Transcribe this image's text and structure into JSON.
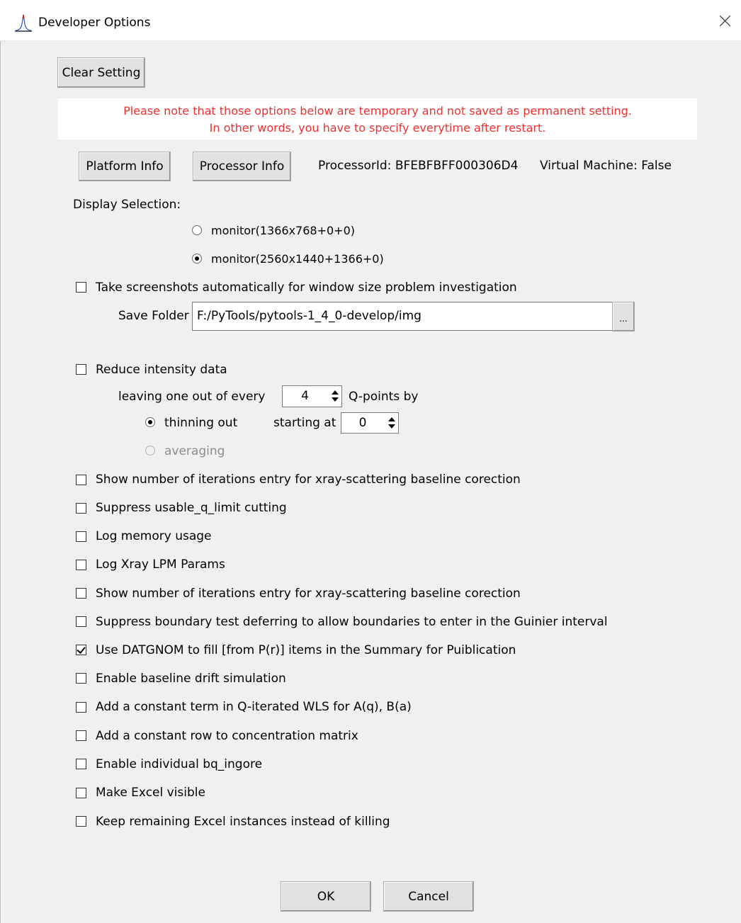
{
  "window": {
    "title": "Developer Options",
    "close_icon": "close-icon",
    "app_icon": "peak-icon"
  },
  "buttons": {
    "clear_setting": "Clear Setting",
    "platform_info": "Platform Info",
    "processor_info": "Processor Info",
    "ok": "OK",
    "cancel": "Cancel",
    "browse": "..."
  },
  "note": {
    "line1": "Please note that those options below are temporary and not saved as permanent setting.",
    "line2": "In other words, you have to specify everytime after restart.",
    "color": "#ee3030"
  },
  "info": {
    "processor_id": "ProcessorId: BFEBFBFF000306D4",
    "virtual_machine": "Virtual Machine: False"
  },
  "display": {
    "label": "Display Selection:",
    "options": [
      {
        "label": "monitor(1366x768+0+0)",
        "selected": false
      },
      {
        "label": "monitor(2560x1440+1366+0)",
        "selected": true
      }
    ]
  },
  "screenshots": {
    "label": "Take screenshots automatically for window size problem investigation",
    "checked": false,
    "save_folder_label": "Save Folder",
    "save_folder_value": "F:/PyTools/pytools-1_4_0-develop/img"
  },
  "reduce": {
    "label": "Reduce intensity data",
    "checked": false,
    "leaving_label": "leaving one out of every",
    "every_value": "4",
    "qpoints_label": "Q-points by",
    "thinning_label": "thinning out",
    "thinning_selected": true,
    "starting_label": "starting at",
    "starting_value": "0",
    "averaging_label": "averaging",
    "averaging_enabled": false
  },
  "options": [
    {
      "label": "Show number of iterations entry for xray-scattering baseline corection",
      "checked": false
    },
    {
      "label": "Suppress usable_q_limit cutting",
      "checked": false
    },
    {
      "label": "Log memory usage",
      "checked": false
    },
    {
      "label": "Log Xray LPM Params",
      "checked": false
    },
    {
      "label": "Show number of iterations entry for xray-scattering baseline corection",
      "checked": false
    },
    {
      "label": "Suppress boundary test deferring to allow boundaries to enter in the Guinier interval",
      "checked": false
    },
    {
      "label": "Use DATGNOM to fill [from P(r)] items in the Summary for Puiblication",
      "checked": true
    },
    {
      "label": "Enable baseline drift simulation",
      "checked": false
    },
    {
      "label": "Add a constant term in Q-iterated WLS for A(q), B(a)",
      "checked": false
    },
    {
      "label": "Add a constant row to concentration matrix",
      "checked": false
    },
    {
      "label": "Enable individual bq_ingore",
      "checked": false
    },
    {
      "label": "Make Excel visible",
      "checked": false
    },
    {
      "label": "Keep remaining Excel instances instead of killing",
      "checked": false
    }
  ]
}
